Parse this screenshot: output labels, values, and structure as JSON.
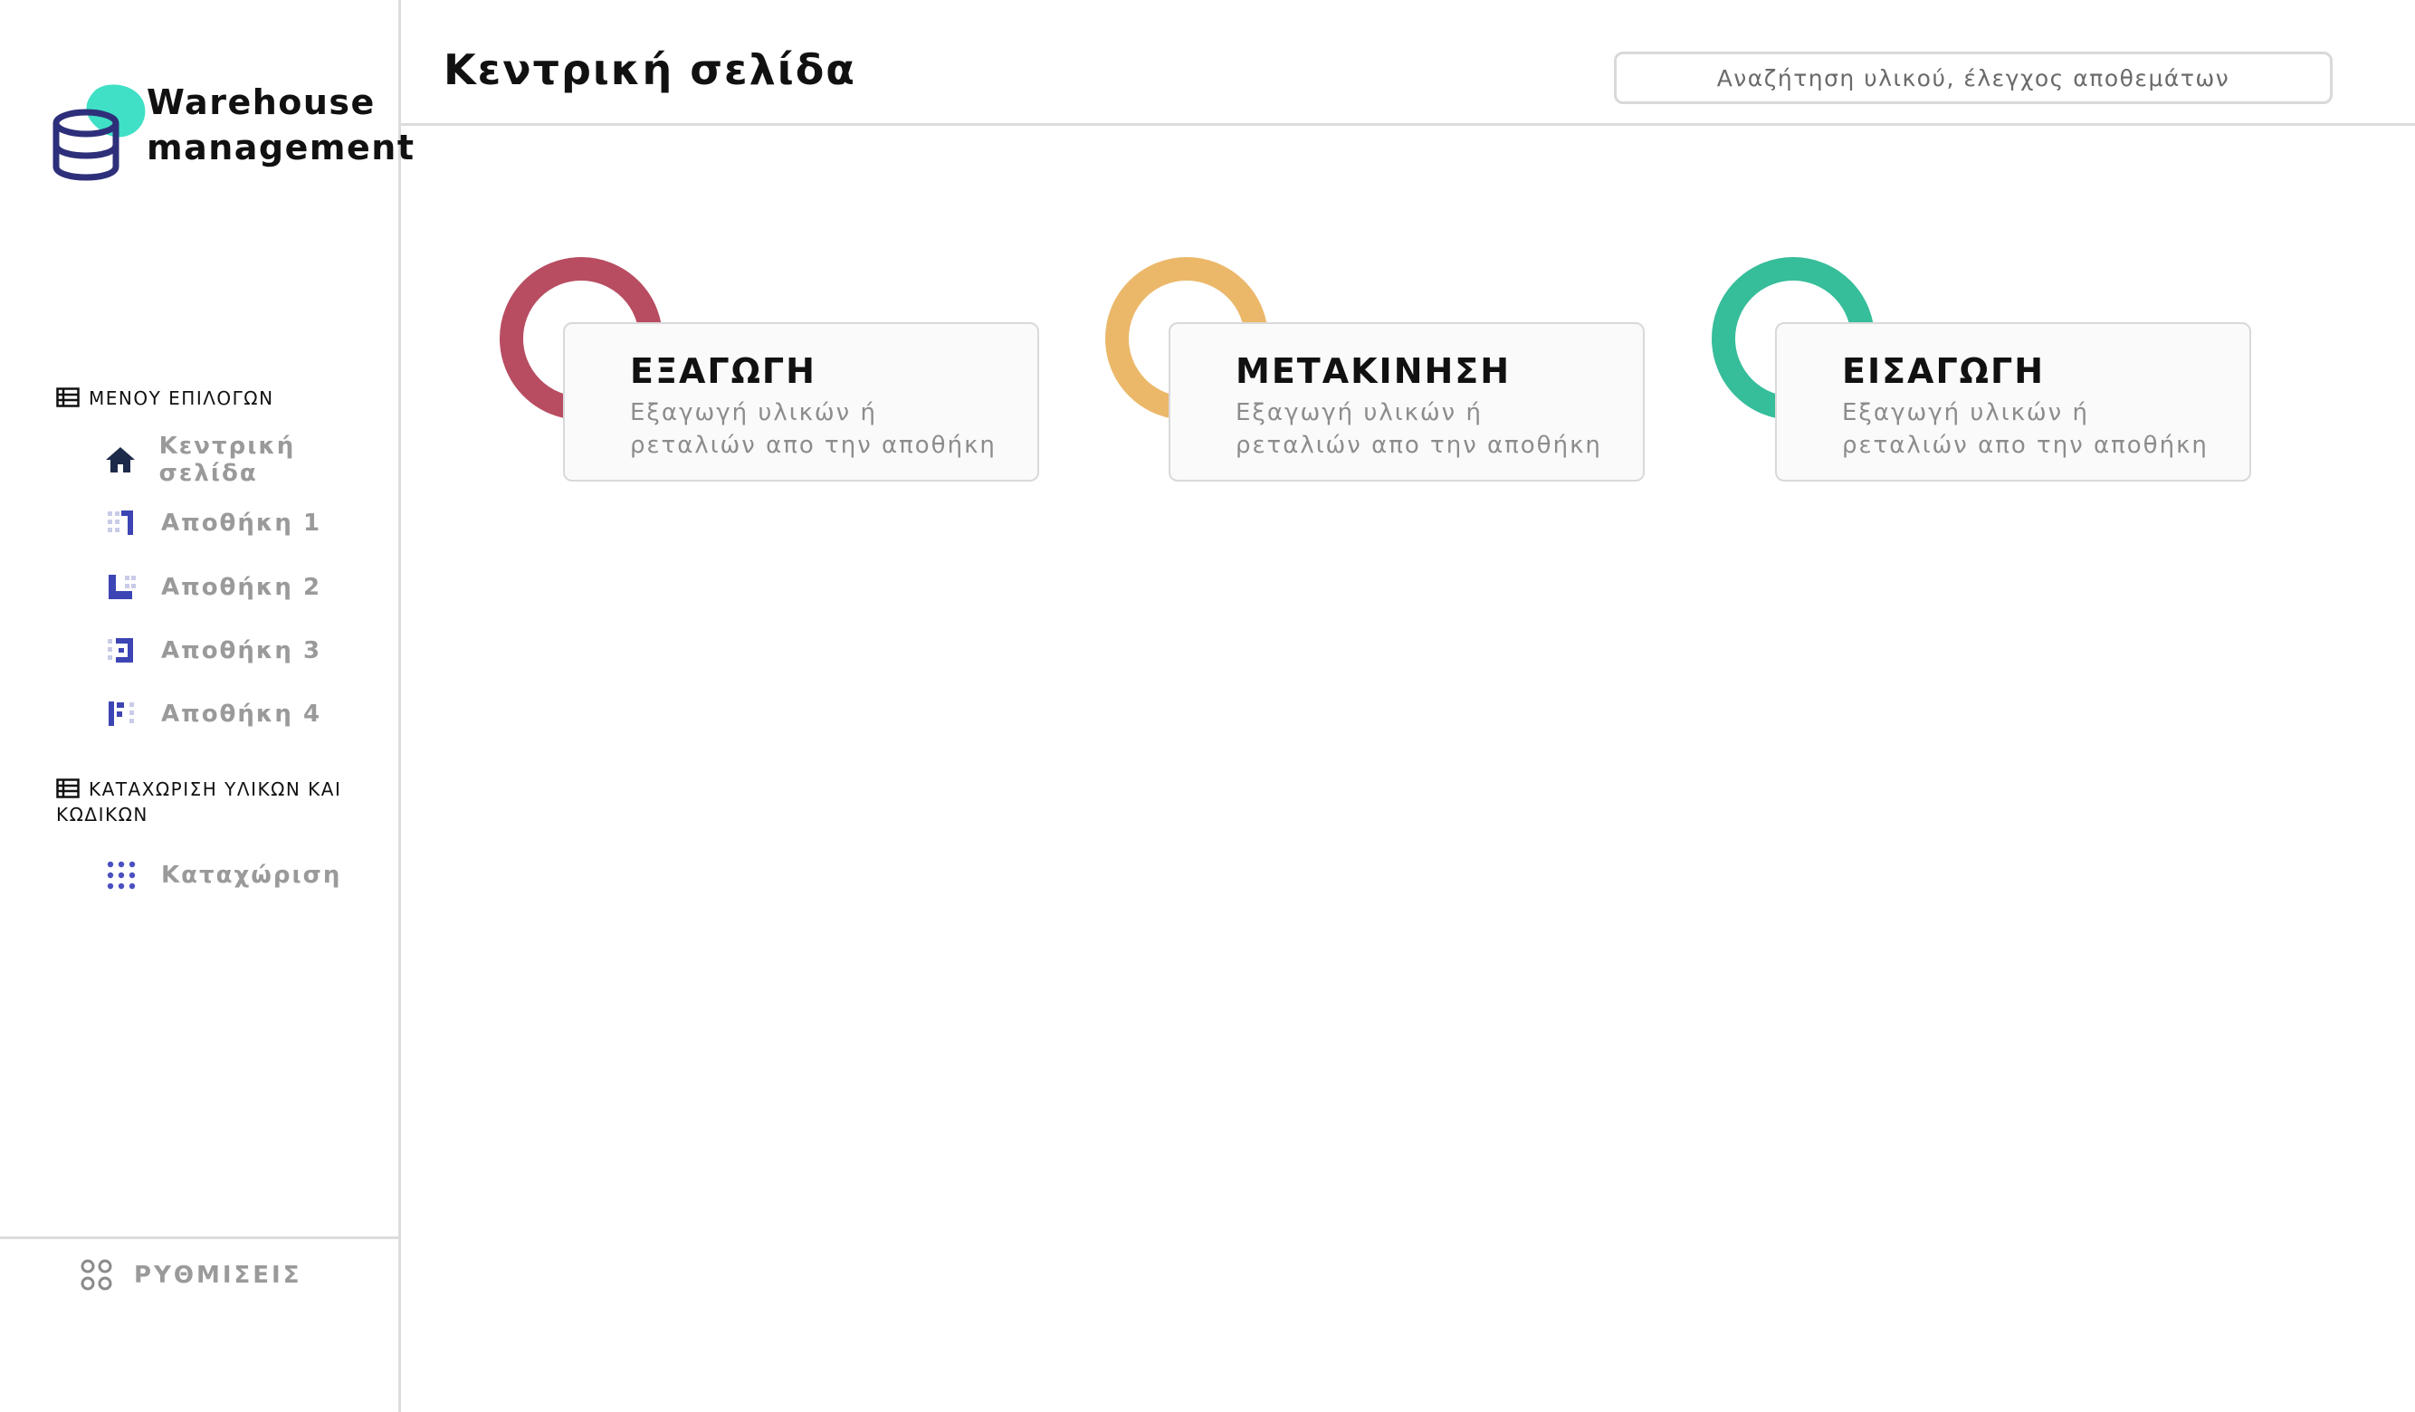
{
  "brand": {
    "line1": "Warehouse",
    "line2": "management"
  },
  "header": {
    "title": "Κεντρική σελίδα",
    "search_placeholder": "Αναζήτηση υλικού, έλεγχος αποθεμάτων"
  },
  "sidebar": {
    "section1": "ΜΕΝΟΥ ΕΠΙΛΟΓΩΝ",
    "items": [
      {
        "label": "Κεντρική σελίδα",
        "icon": "home-icon"
      },
      {
        "label": "Αποθήκη 1",
        "icon": "warehouse-1-icon"
      },
      {
        "label": "Αποθήκη 2",
        "icon": "warehouse-2-icon"
      },
      {
        "label": "Αποθήκη 3",
        "icon": "warehouse-3-icon"
      },
      {
        "label": "Αποθήκη 4",
        "icon": "warehouse-4-icon"
      }
    ],
    "section2": "ΚΑΤΑΧΩΡΙΣΗ ΥΛΙΚΩΝ ΚΑΙ ΚΩΔΙΚΩΝ",
    "entry": {
      "label": "Καταχώριση",
      "icon": "grid-dots-icon"
    },
    "settings": {
      "label": "ΡΥΘΜΙΣΕΙΣ",
      "icon": "settings-circles-icon"
    }
  },
  "cards": [
    {
      "title": "ΕΞΑΓΩΓΗ",
      "desc_line1": "Εξαγωγή υλικών ή",
      "desc_line2": "ρεταλιών απο την αποθήκη",
      "color": "#b84d62"
    },
    {
      "title": "ΜΕΤΑΚΙΝΗΣΗ",
      "desc_line1": "Εξαγωγή υλικών ή",
      "desc_line2": "ρεταλιών απο την αποθήκη",
      "color": "#ebb86a"
    },
    {
      "title": "ΕΙΣΑΓΩΓΗ",
      "desc_line1": "Εξαγωγή υλικών ή",
      "desc_line2": "ρεταλιών απο την αποθήκη",
      "color": "#36bd9a"
    }
  ],
  "colors": {
    "accent": "#3d45b5",
    "logo_teal": "#3fe0c5",
    "logo_navy": "#2e2f7a",
    "home_icon": "#1e2a4a"
  }
}
